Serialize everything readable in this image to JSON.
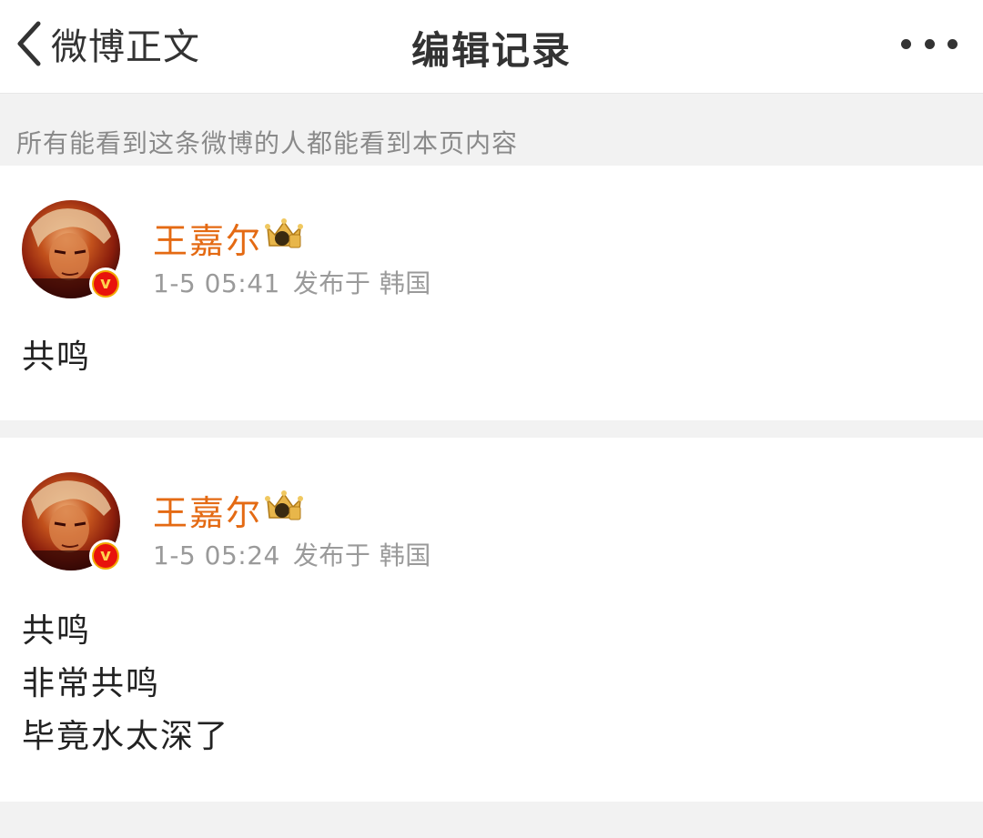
{
  "nav": {
    "back_label": "微博正文",
    "title": "编辑记录",
    "more_icon": "more-horizontal-icon"
  },
  "notice": "所有能看到这条微博的人都能看到本页内容",
  "colors": {
    "username": "#e46a13",
    "meta": "#9a9a9a",
    "background": "#f2f2f2",
    "verified_badge": "#f2a700"
  },
  "records": [
    {
      "username": "王嘉尔",
      "time": "1-5 05:41",
      "location": "发布于 韩国",
      "content_lines": [
        "共鸣"
      ]
    },
    {
      "username": "王嘉尔",
      "time": "1-5 05:24",
      "location": "发布于 韩国",
      "content_lines": [
        "共鸣",
        "非常共鸣",
        "毕竟水太深了"
      ]
    }
  ]
}
